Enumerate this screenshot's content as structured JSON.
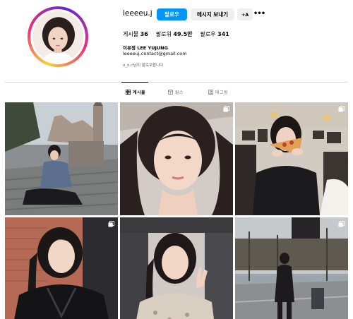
{
  "profile": {
    "username": "leeeeu.j",
    "follow_label": "팔로우",
    "message_label": "메시지 보내기",
    "add_label": "+A",
    "more_label": "•••",
    "stats": [
      {
        "label": "게시물",
        "value": "36"
      },
      {
        "label": "팔로워",
        "value": "49.5만"
      },
      {
        "label": "팔로우",
        "value": "341"
      }
    ],
    "full_name": "이유정 LEE YUJUNG",
    "email": "leeeeuj.contact@gmail.com",
    "followed_by": "o_o.ri님이 팔로우합니다"
  },
  "tabs": [
    {
      "label": "게시물",
      "icon": "grid-icon",
      "active": true
    },
    {
      "label": "릴스",
      "icon": "reels-icon",
      "active": false
    },
    {
      "label": "태그됨",
      "icon": "tagged-icon",
      "active": false
    }
  ],
  "posts": [
    {
      "subject": "castle-stairs-sitting",
      "multi": false
    },
    {
      "subject": "selfie-closeup",
      "multi": true
    },
    {
      "subject": "cafe-pizza",
      "multi": true
    },
    {
      "subject": "leather-jacket-selfie",
      "multi": true
    },
    {
      "subject": "car-peace-sign",
      "multi": false
    },
    {
      "subject": "street-standing",
      "multi": true
    }
  ],
  "colors": {
    "accent": "#0095f6",
    "secondary_button": "#efefef",
    "divider": "#dbdbdb",
    "muted_text": "#737373"
  }
}
